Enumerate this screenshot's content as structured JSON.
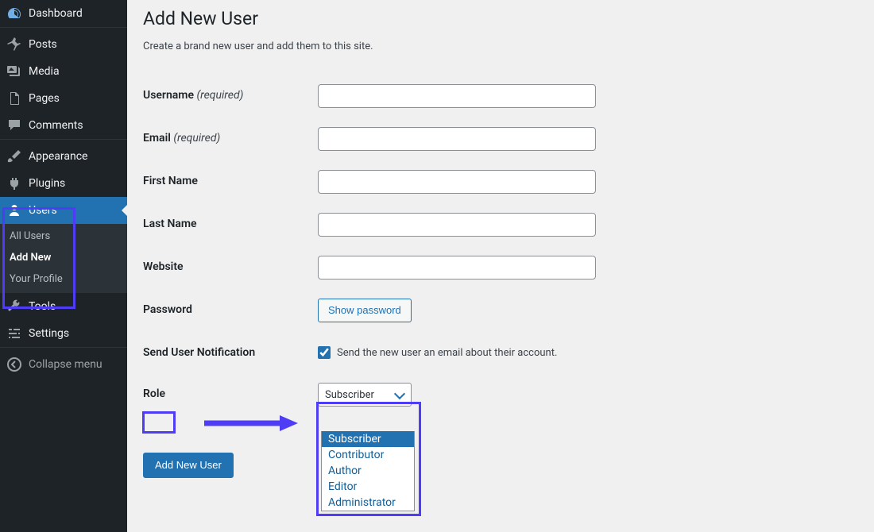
{
  "page": {
    "title": "Add New User",
    "description": "Create a brand new user and add them to this site."
  },
  "sidebar": {
    "items": [
      {
        "label": "Dashboard"
      },
      {
        "label": "Posts"
      },
      {
        "label": "Media"
      },
      {
        "label": "Pages"
      },
      {
        "label": "Comments"
      },
      {
        "label": "Appearance"
      },
      {
        "label": "Plugins"
      },
      {
        "label": "Users"
      },
      {
        "label": "Tools"
      },
      {
        "label": "Settings"
      }
    ],
    "submenu": {
      "all_users": "All Users",
      "add_new": "Add New",
      "your_profile": "Your Profile"
    },
    "collapse": "Collapse menu"
  },
  "form": {
    "labels": {
      "username": "Username",
      "email": "Email",
      "first_name": "First Name",
      "last_name": "Last Name",
      "website": "Website",
      "password": "Password",
      "notification": "Send User Notification",
      "role": "Role",
      "required": "(required)"
    },
    "show_password": "Show password",
    "notification_text": "Send the new user an email about their account.",
    "role_selected": "Subscriber",
    "role_options": [
      "Subscriber",
      "Contributor",
      "Author",
      "Editor",
      "Administrator"
    ],
    "submit": "Add New User"
  },
  "values": {
    "username": "",
    "email": "",
    "first_name": "",
    "last_name": "",
    "website": "",
    "notification_checked": true
  },
  "annotations": {
    "highlight_color": "#4f3df5"
  }
}
